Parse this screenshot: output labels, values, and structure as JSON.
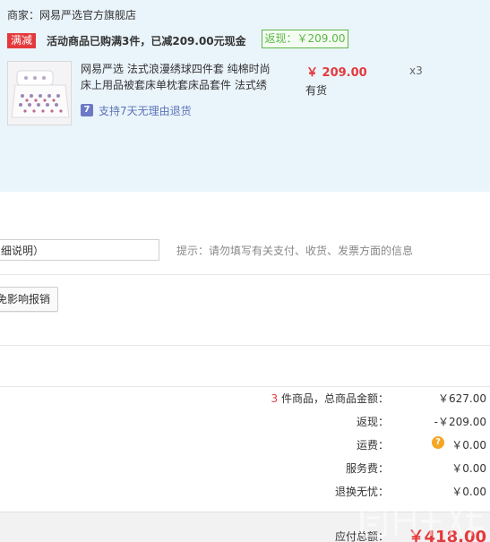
{
  "shop": {
    "label": "商家：网易严选官方旗舰店"
  },
  "promotion": {
    "tag": "满减",
    "text": "活动商品已购满3件，已减209.00元现金",
    "rebate": "返现：￥209.00"
  },
  "item": {
    "title": "网易严选 法式浪漫绣球四件套 纯棉时尚床上用品被套床单枕套床品套件 法式绣",
    "price": "￥ 209.00",
    "stock": "有货",
    "quantity": "x3",
    "service_icon": "7",
    "service": "支持7天无理由退货"
  },
  "remark": {
    "value": "细说明）",
    "hint": "提示：请勿填写有关支付、收货、发票方面的信息"
  },
  "invoice": {
    "button_label": "免影响报销"
  },
  "summary": {
    "count": "3",
    "count_label": " 件商品，总商品金额：",
    "goods_total": "￥627.00",
    "rebate_label": "返现：",
    "rebate_value": "-￥209.00",
    "freight_label": "运费：",
    "freight_icon": "?",
    "freight_value": "￥0.00",
    "service_fee_label": "服务费：",
    "service_fee_value": "￥0.00",
    "worry_free_label": "退换无忧：",
    "worry_free_value": "￥0.00",
    "payable_label": "应付总额：",
    "payable_value": "￥418.00"
  },
  "colors": {
    "accent_red": "#e4393c",
    "rebate_green": "#5ab846",
    "order_bg": "#eaf4fb",
    "service_blue": "#5c74b8",
    "warning_orange": "#f5a623"
  }
}
